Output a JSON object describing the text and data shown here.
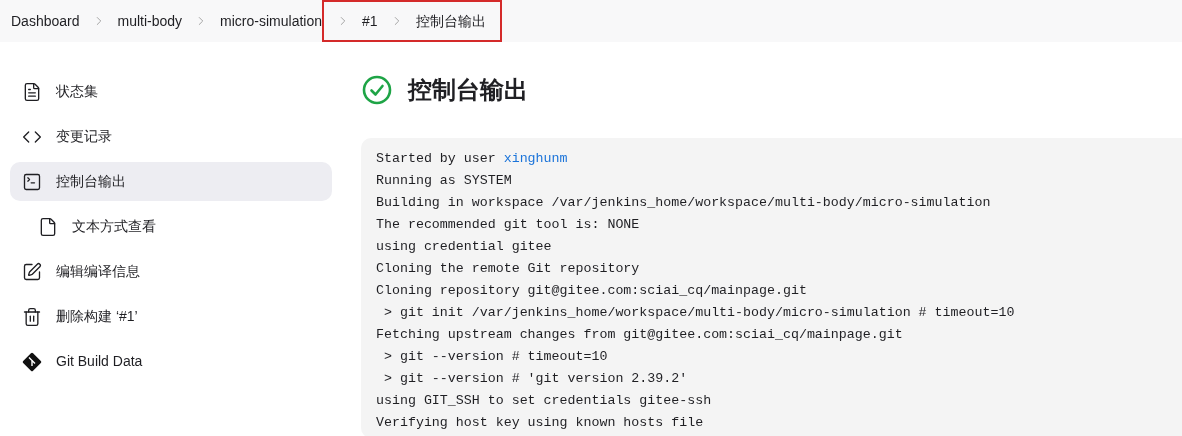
{
  "breadcrumbs": [
    {
      "label": "Dashboard",
      "highlighted": false
    },
    {
      "label": "multi-body",
      "highlighted": false
    },
    {
      "label": "micro-simulation",
      "highlighted": false
    },
    {
      "label": "#1",
      "highlighted": true
    },
    {
      "label": "控制台输出",
      "highlighted": true
    }
  ],
  "sidebar": {
    "items": [
      {
        "kind": "status",
        "label": "状态集",
        "selected": false
      },
      {
        "kind": "changes",
        "label": "变更记录",
        "selected": false
      },
      {
        "kind": "console",
        "label": "控制台输出",
        "selected": true,
        "children": [
          {
            "kind": "text",
            "label": "文本方式查看",
            "selected": false
          }
        ]
      },
      {
        "kind": "edit",
        "label": "编辑编译信息",
        "selected": false
      },
      {
        "kind": "delete",
        "label": "删除构建 ‘#1’",
        "selected": false
      },
      {
        "kind": "git",
        "label": "Git Build Data",
        "selected": false
      }
    ]
  },
  "main": {
    "title": "控制台输出",
    "success": true,
    "console_lines": [
      {
        "text": "Started by user ",
        "link": "xinghunm"
      },
      {
        "text": "Running as SYSTEM"
      },
      {
        "text": "Building in workspace /var/jenkins_home/workspace/multi-body/micro-simulation"
      },
      {
        "text": "The recommended git tool is: NONE"
      },
      {
        "text": "using credential gitee"
      },
      {
        "text": "Cloning the remote Git repository"
      },
      {
        "text": "Cloning repository git@gitee.com:sciai_cq/mainpage.git"
      },
      {
        "text": " > git init /var/jenkins_home/workspace/multi-body/micro-simulation # timeout=10"
      },
      {
        "text": "Fetching upstream changes from git@gitee.com:sciai_cq/mainpage.git"
      },
      {
        "text": " > git --version # timeout=10"
      },
      {
        "text": " > git --version # 'git version 2.39.2'"
      },
      {
        "text": "using GIT_SSH to set credentials gitee-ssh"
      },
      {
        "text": "Verifying host key using known hosts file"
      }
    ]
  }
}
